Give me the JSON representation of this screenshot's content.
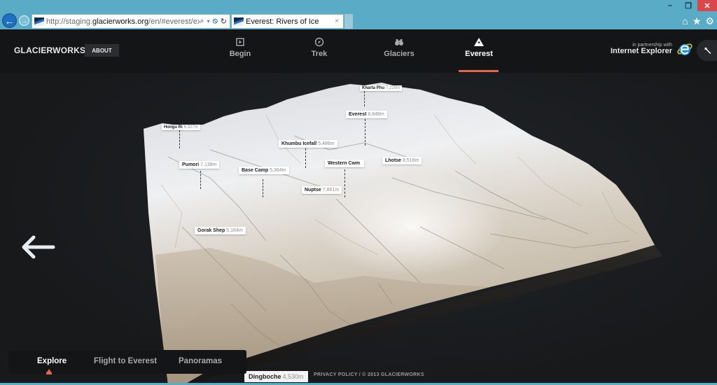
{
  "browser": {
    "url_prefix": "http://staging.",
    "url_domain": "glacierworks.org",
    "url_suffix": "/en/#everest/explc",
    "tab_title": "Everest: Rivers of Ice",
    "tab_close": "×",
    "window_minimize": "–",
    "window_restore": "❐",
    "window_close": "✕",
    "back_glyph": "←",
    "forward_glyph": "→",
    "search_glyph": "⌕",
    "dropdown_glyph": "▾",
    "stop_glyph": "⦸",
    "refresh_glyph": "↻",
    "home_glyph": "⌂",
    "favorites_glyph": "★",
    "settings_glyph": "⚙"
  },
  "header": {
    "brand": "GLACIERWORKS",
    "about_label": "ABOUT",
    "nav": [
      {
        "label": "Begin",
        "icon": "play-square-icon"
      },
      {
        "label": "Trek",
        "icon": "compass-icon"
      },
      {
        "label": "Glaciers",
        "icon": "binoculars-icon"
      },
      {
        "label": "Everest",
        "icon": "mountain-icon",
        "active": true
      }
    ],
    "partner_small": "in partnership with",
    "partner_big": "Internet Explorer",
    "tools_glyph": "🔧",
    "accent_color": "#e2674a"
  },
  "map": {
    "labels": [
      {
        "name": "Kharta Phu",
        "elevation": "7,220m"
      },
      {
        "name": "Everest",
        "elevation": "8,848m"
      },
      {
        "name": "Hongu Ri",
        "elevation": "6,327m"
      },
      {
        "name": "Khumbu Icefall",
        "elevation": "5,486m"
      },
      {
        "name": "Pumori",
        "elevation": "7,138m"
      },
      {
        "name": "Western Cwm",
        "elevation": ""
      },
      {
        "name": "Lhotse",
        "elevation": "8,516m"
      },
      {
        "name": "Base Camp",
        "elevation": "5,364m"
      },
      {
        "name": "Nuptse",
        "elevation": "7,861m"
      },
      {
        "name": "Gorak Shep",
        "elevation": "5,164m"
      },
      {
        "name": "Dingboche",
        "elevation": "4,530m"
      }
    ]
  },
  "modes": {
    "tabs": [
      {
        "label": "Explore",
        "active": true
      },
      {
        "label": "Flight to Everest"
      },
      {
        "label": "Panoramas"
      }
    ]
  },
  "footer": {
    "text": "PRIVACY POLICY / © 2013 GLACIERWORKS"
  }
}
